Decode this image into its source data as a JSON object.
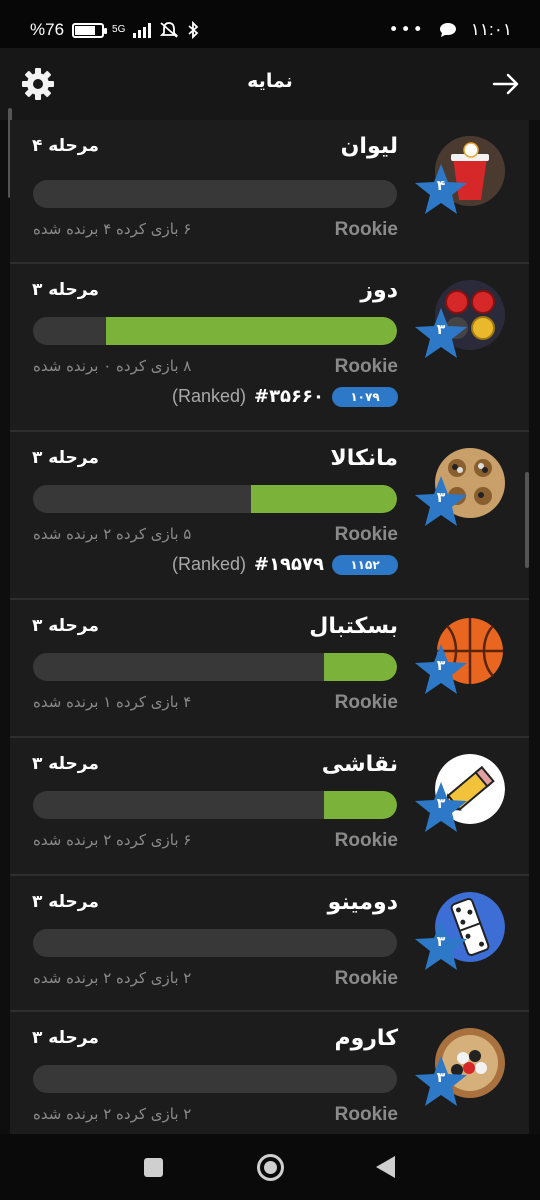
{
  "status_bar": {
    "battery_text": "%76",
    "battery_level": 0.76,
    "network_label": "5G",
    "time": "۱۱:۰۱",
    "overflow_dots": "•••",
    "icons": [
      "battery-icon",
      "signal-icon",
      "mute-icon",
      "bluetooth-icon",
      "chat-icon"
    ]
  },
  "header": {
    "title": "نمایه",
    "left_icon": "gear-icon",
    "right_icon": "arrow-right-icon"
  },
  "colors": {
    "progress_fill": "#7bb239",
    "progress_track": "#383838",
    "star": "#2d79c7",
    "card_bg": "#1c1c1c"
  },
  "games": [
    {
      "name": "لیوان",
      "level_label": "مرحله ۴",
      "star_level": "۴",
      "progress": 0,
      "stats": "۶ بازی کرده   ۴ برنده شده",
      "rank": "Rookie",
      "icon": "beer-pong-cup-icon",
      "ranked": null
    },
    {
      "name": "دوز",
      "level_label": "مرحله ۳",
      "star_level": "۳",
      "progress": 0.8,
      "stats": "۸ بازی کرده   ۰ برنده شده",
      "rank": "Rookie",
      "icon": "tic-tac-toe-stars-icon",
      "ranked": {
        "text": "(Ranked)",
        "position": "#۳۵۶۶۰",
        "rating": "۱۰۷۹"
      }
    },
    {
      "name": "مانکالا",
      "level_label": "مرحله ۳",
      "star_level": "۳",
      "progress": 0.4,
      "stats": "۵ بازی کرده   ۲ برنده شده",
      "rank": "Rookie",
      "icon": "mancala-board-icon",
      "ranked": {
        "text": "(Ranked)",
        "position": "#۱۹۵۷۹",
        "rating": "۱۱۵۲"
      }
    },
    {
      "name": "بسکتبال",
      "level_label": "مرحله ۳",
      "star_level": "۳",
      "progress": 0.2,
      "stats": "۴ بازی کرده   ۱ برنده شده",
      "rank": "Rookie",
      "icon": "basketball-icon",
      "ranked": null
    },
    {
      "name": "نقاشی",
      "level_label": "مرحله ۳",
      "star_level": "۳",
      "progress": 0.2,
      "stats": "۶ بازی کرده   ۲ برنده شده",
      "rank": "Rookie",
      "icon": "pencil-drawing-icon",
      "ranked": null
    },
    {
      "name": "دومینو",
      "level_label": "مرحله ۳",
      "star_level": "۳",
      "progress": 0,
      "stats": "۲ بازی کرده   ۲ برنده شده",
      "rank": "Rookie",
      "icon": "domino-tile-icon",
      "ranked": null
    },
    {
      "name": "کاروم",
      "level_label": "مرحله ۳",
      "star_level": "۳",
      "progress": 0,
      "stats": "۲ بازی کرده   ۲ برنده شده",
      "rank": "Rookie",
      "icon": "carrom-board-icon",
      "ranked": null
    }
  ],
  "nav_bar": {
    "icons": [
      "recent-apps-icon",
      "home-icon",
      "back-icon"
    ]
  }
}
